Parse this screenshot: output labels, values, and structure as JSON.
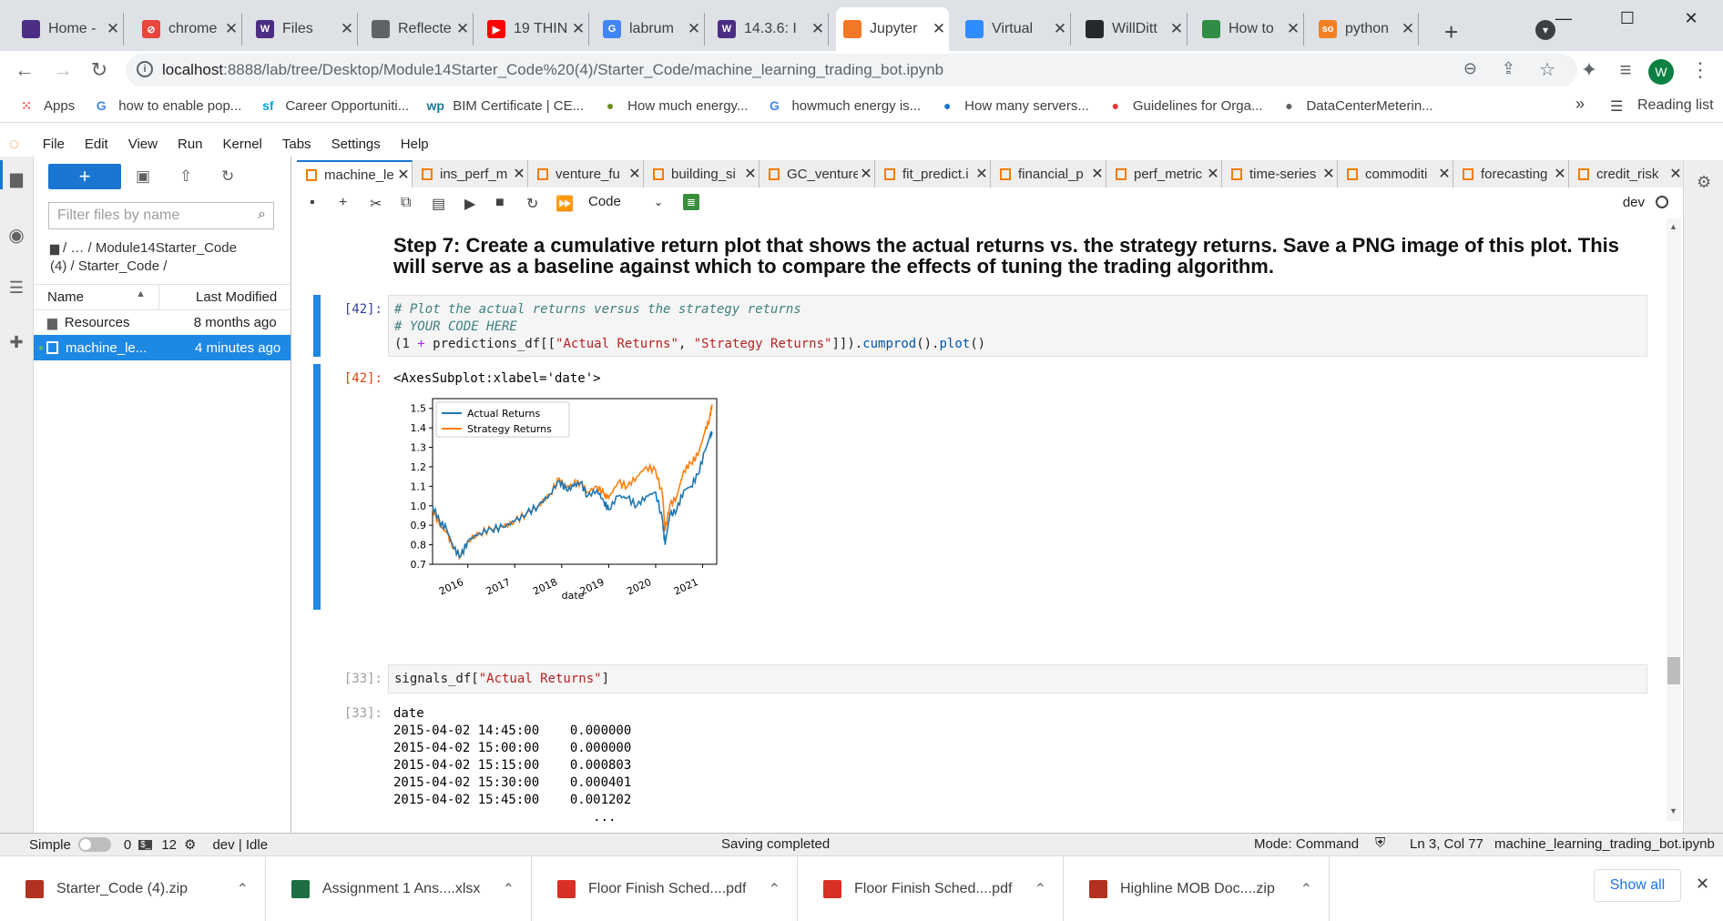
{
  "browser": {
    "tabs": [
      {
        "label": "Home -",
        "favicon": "MY UW",
        "color": "#4b2e83"
      },
      {
        "label": "chrome",
        "favicon": "⊘",
        "color": "#e8453c"
      },
      {
        "label": "Files",
        "favicon": "W",
        "color": "#4b2e83"
      },
      {
        "label": "Reflecte",
        "favicon": "globe",
        "color": "#5f6368"
      },
      {
        "label": "19 THIN",
        "favicon": "▶",
        "color": "#ff0000"
      },
      {
        "label": "labrum",
        "favicon": "G",
        "color": "#4285f4"
      },
      {
        "label": "14.3.6: I",
        "favicon": "W",
        "color": "#4b2e83"
      },
      {
        "label": "Jupyter",
        "favicon": "jupyter",
        "color": "#f37726"
      },
      {
        "label": "Virtual",
        "favicon": "zoom",
        "color": "#2d8cff"
      },
      {
        "label": "WillDitt",
        "favicon": "github",
        "color": "#24292e"
      },
      {
        "label": "How to",
        "favicon": "geeks",
        "color": "#2f8d46"
      },
      {
        "label": "python",
        "favicon": "so",
        "color": "#f48024"
      }
    ],
    "new_tab": "+",
    "url_host": "localhost",
    "url_path": ":8888/lab/tree/Desktop/Module14Starter_Code%20(4)/Starter_Code/machine_learning_trading_bot.ipynb",
    "profile_initial": "W",
    "bookmarks": [
      {
        "label": "Apps",
        "icon": "apps-grid-icon"
      },
      {
        "label": "how to enable pop...",
        "icon": "G"
      },
      {
        "label": "Career Opportuniti...",
        "icon": "sf"
      },
      {
        "label": "BIM Certificate | CE...",
        "icon": "wp"
      },
      {
        "label": "How much energy...",
        "icon": "img"
      },
      {
        "label": "howmuch energy is...",
        "icon": "G"
      },
      {
        "label": "How many servers...",
        "icon": "drop"
      },
      {
        "label": "Guidelines for Orga...",
        "icon": "red"
      },
      {
        "label": "DataCenterMeterin...",
        "icon": "globe"
      }
    ],
    "bookmarks_more": "»",
    "reading_list": "Reading list"
  },
  "jupyter": {
    "menu": [
      "File",
      "Edit",
      "View",
      "Run",
      "Kernel",
      "Tabs",
      "Settings",
      "Help"
    ],
    "filebrowser": {
      "new_label": "+",
      "filter_placeholder": "Filter files by name",
      "breadcrumb_line1": "/  …  / Module14Starter_Code",
      "breadcrumb_line2": "(4) / Starter_Code /",
      "col_name": "Name",
      "col_modified": "Last Modified",
      "files": [
        {
          "name": "Resources",
          "modified": "8 months ago",
          "type": "folder",
          "selected": false
        },
        {
          "name": "machine_le...",
          "modified": "4 minutes ago",
          "type": "notebook",
          "selected": true
        }
      ]
    },
    "notebook_tabs": [
      "machine_le",
      "ins_perf_m",
      "venture_fu",
      "building_si",
      "GC_venture",
      "fit_predict.i",
      "financial_p",
      "perf_metric",
      "time-series",
      "commoditi",
      "forecasting",
      "credit_risk"
    ],
    "cell_type": "Code",
    "kernel_name": "dev",
    "heading": "Step 7: Create a cumulative return plot that shows the actual returns vs. the strategy returns. Save a PNG image of this plot. This will serve as a baseline against which to compare the effects of tuning the trading algorithm.",
    "cell42": {
      "in_prompt": "[42]:",
      "line1": "# Plot the actual returns versus the strategy returns",
      "line2": "# YOUR CODE HERE",
      "code_a": "(1 ",
      "code_op": "+",
      "code_b": " predictions_df[[",
      "code_s1": "\"Actual Returns\"",
      "code_c": ", ",
      "code_s2": "\"Strategy Returns\"",
      "code_d": "]]).",
      "code_f1": "cumprod",
      "code_e": "().",
      "code_f2": "plot",
      "code_g": "()",
      "out_prompt": "[42]:",
      "out_text": "<AxesSubplot:xlabel='date'>"
    },
    "cell33": {
      "in_prompt": "[33]:",
      "code_a": "signals_df[",
      "code_s": "\"Actual Returns\"",
      "code_b": "]",
      "out_prompt": "[33]:",
      "out_lines": [
        "date",
        "2015-04-02 14:45:00    0.000000",
        "2015-04-02 15:00:00    0.000000",
        "2015-04-02 15:15:00    0.000803",
        "2015-04-02 15:30:00    0.000401",
        "2015-04-02 15:45:00    0.001202",
        "                          ..."
      ]
    },
    "status": {
      "mode_label": "Simple",
      "terminals": "0",
      "kernels": "12",
      "kernel_status": "dev | Idle",
      "message": "Saving completed",
      "mode": "Mode: Command",
      "cursor": "Ln 3, Col 77",
      "filename": "machine_learning_trading_bot.ipynb"
    }
  },
  "downloads": {
    "items": [
      {
        "name": "Starter_Code (4).zip",
        "color": "#b23121"
      },
      {
        "name": "Assignment 1 Ans....xlsx",
        "color": "#1d6f42"
      },
      {
        "name": "Floor Finish Sched....pdf",
        "color": "#d93025"
      },
      {
        "name": "Floor Finish Sched....pdf",
        "color": "#d93025"
      },
      {
        "name": "Highline MOB Doc....zip",
        "color": "#b23121"
      }
    ],
    "show_all": "Show all"
  },
  "chart_data": {
    "type": "line",
    "xlabel": "date",
    "x_tick_labels": [
      "2016",
      "2017",
      "2018",
      "2019",
      "2020",
      "2021"
    ],
    "y_tick_labels": [
      "0.7",
      "0.8",
      "0.9",
      "1.0",
      "1.1",
      "1.2",
      "1.3",
      "1.4",
      "1.5"
    ],
    "ylim": [
      0.7,
      1.55
    ],
    "xlim": [
      2015.25,
      2021.3
    ],
    "legend_position": "upper-left",
    "series": [
      {
        "name": "Actual Returns",
        "color": "#1f77b4",
        "points": [
          [
            2015.25,
            1.0
          ],
          [
            2015.4,
            0.92
          ],
          [
            2015.55,
            0.88
          ],
          [
            2015.7,
            0.78
          ],
          [
            2015.85,
            0.74
          ],
          [
            2016.0,
            0.82
          ],
          [
            2016.25,
            0.86
          ],
          [
            2016.5,
            0.88
          ],
          [
            2016.75,
            0.89
          ],
          [
            2017.0,
            0.92
          ],
          [
            2017.25,
            0.96
          ],
          [
            2017.5,
            1.0
          ],
          [
            2017.75,
            1.06
          ],
          [
            2017.95,
            1.13
          ],
          [
            2018.1,
            1.08
          ],
          [
            2018.25,
            1.1
          ],
          [
            2018.4,
            1.12
          ],
          [
            2018.55,
            1.05
          ],
          [
            2018.75,
            1.08
          ],
          [
            2018.9,
            1.02
          ],
          [
            2019.0,
            0.98
          ],
          [
            2019.2,
            1.05
          ],
          [
            2019.4,
            1.04
          ],
          [
            2019.6,
            1.0
          ],
          [
            2019.8,
            1.05
          ],
          [
            2020.0,
            1.07
          ],
          [
            2020.15,
            0.92
          ],
          [
            2020.2,
            0.8
          ],
          [
            2020.3,
            0.95
          ],
          [
            2020.45,
            0.98
          ],
          [
            2020.6,
            1.08
          ],
          [
            2020.75,
            1.1
          ],
          [
            2020.9,
            1.16
          ],
          [
            2021.05,
            1.28
          ],
          [
            2021.15,
            1.35
          ],
          [
            2021.2,
            1.38
          ]
        ]
      },
      {
        "name": "Strategy Returns",
        "color": "#ff7f0e",
        "points": [
          [
            2015.25,
            0.99
          ],
          [
            2015.4,
            0.9
          ],
          [
            2015.55,
            0.86
          ],
          [
            2015.7,
            0.78
          ],
          [
            2015.85,
            0.74
          ],
          [
            2016.0,
            0.82
          ],
          [
            2016.25,
            0.86
          ],
          [
            2016.5,
            0.88
          ],
          [
            2016.75,
            0.89
          ],
          [
            2017.0,
            0.92
          ],
          [
            2017.25,
            0.96
          ],
          [
            2017.5,
            1.0
          ],
          [
            2017.75,
            1.06
          ],
          [
            2017.95,
            1.14
          ],
          [
            2018.1,
            1.09
          ],
          [
            2018.25,
            1.11
          ],
          [
            2018.4,
            1.12
          ],
          [
            2018.55,
            1.07
          ],
          [
            2018.75,
            1.1
          ],
          [
            2018.9,
            1.06
          ],
          [
            2019.0,
            1.04
          ],
          [
            2019.2,
            1.12
          ],
          [
            2019.4,
            1.1
          ],
          [
            2019.6,
            1.15
          ],
          [
            2019.8,
            1.2
          ],
          [
            2020.0,
            1.18
          ],
          [
            2020.15,
            1.05
          ],
          [
            2020.2,
            0.87
          ],
          [
            2020.3,
            1.0
          ],
          [
            2020.45,
            1.05
          ],
          [
            2020.6,
            1.18
          ],
          [
            2020.75,
            1.22
          ],
          [
            2020.9,
            1.26
          ],
          [
            2021.05,
            1.38
          ],
          [
            2021.15,
            1.45
          ],
          [
            2021.2,
            1.52
          ]
        ]
      }
    ]
  }
}
